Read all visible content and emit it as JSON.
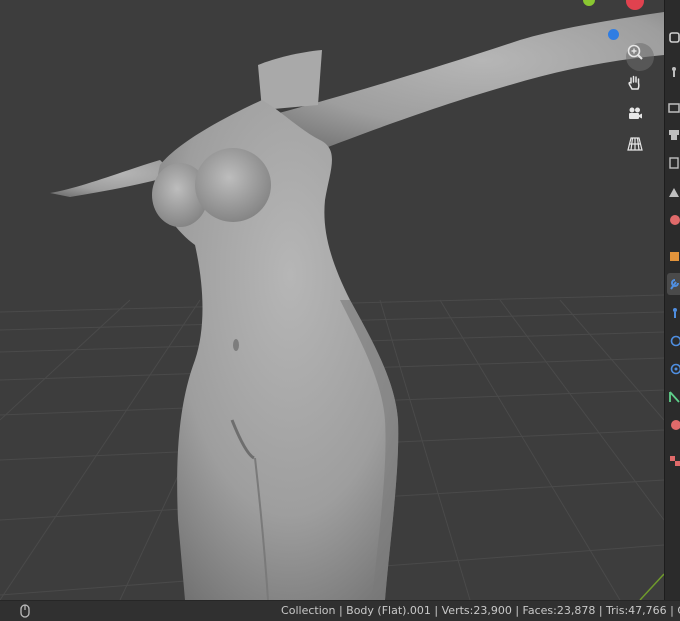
{
  "statusbar": {
    "text": "Collection | Body (Flat).001 | Verts:23,900 | Faces:23,878 | Tris:47,766 | O"
  },
  "navigation_gizmo": {
    "items": [
      {
        "name": "zoom",
        "icon": "zoom-icon"
      },
      {
        "name": "pan",
        "icon": "hand-icon"
      },
      {
        "name": "camera",
        "icon": "camera-icon"
      },
      {
        "name": "perspective",
        "icon": "grid-icon"
      }
    ]
  },
  "properties_tabs": [
    {
      "name": "tool",
      "icon": "wrench-icon",
      "color": "#bfbfbf"
    },
    {
      "name": "render",
      "icon": "render-icon",
      "color": "#bfbfbf"
    },
    {
      "name": "output",
      "icon": "printer-icon",
      "color": "#bfbfbf"
    },
    {
      "name": "view-layer",
      "icon": "layers-icon",
      "color": "#bfbfbf"
    },
    {
      "name": "scene",
      "icon": "scene-icon",
      "color": "#bfbfbf"
    },
    {
      "name": "world",
      "icon": "world-icon",
      "color": "#e06a6a"
    },
    {
      "name": "object",
      "icon": "object-icon",
      "color": "#e3943b"
    },
    {
      "name": "modifier",
      "icon": "wrench-blue-icon",
      "color": "#4f8ee0"
    },
    {
      "name": "particles",
      "icon": "particles-icon",
      "color": "#4f8ee0"
    },
    {
      "name": "physics",
      "icon": "physics-icon",
      "color": "#4f8ee0"
    },
    {
      "name": "constraints",
      "icon": "constraint-icon",
      "color": "#4f8ee0"
    },
    {
      "name": "data",
      "icon": "mesh-data-icon",
      "color": "#5fd08b"
    },
    {
      "name": "material",
      "icon": "material-icon",
      "color": "#e06a6a"
    },
    {
      "name": "texture",
      "icon": "checker-icon",
      "color": "#e06a6a"
    }
  ],
  "colors": {
    "viewport_bg": "#3d3d3d",
    "grid_line": "#4a4a4a",
    "axis_green": "#6f9a2c",
    "gizmo_blue": "#2f7de3",
    "gizmo_red": "#e0424f",
    "gizmo_green": "#8ac731",
    "mesh": "#9a9a9a"
  }
}
